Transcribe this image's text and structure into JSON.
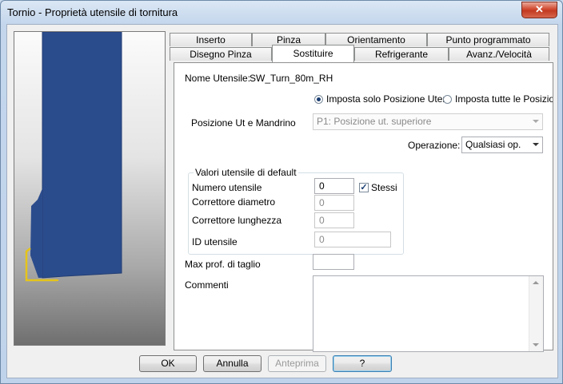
{
  "window": {
    "title": "Tornio - Proprietà utensile di tornitura",
    "close_glyph": "✕"
  },
  "tabs_row1": [
    "Inserto",
    "Pinza",
    "Orientamento",
    "Punto programmato"
  ],
  "tabs_row2": [
    "Disegno Pinza",
    "Sostituire",
    "Refrigerante",
    "Avanz./Velocità"
  ],
  "active_tab": "Sostituire",
  "form": {
    "tool_name_label": "Nome Utensile:",
    "tool_name_value": "SW_Turn_80m_RH",
    "radio_single": {
      "label": "Imposta solo Posizione Uten",
      "checked": true
    },
    "radio_all": {
      "label": "Imposta tutte le Posizio",
      "checked": false
    },
    "position_label": "Posizione Ut e Mandrino",
    "position_value": "P1: Posizione ut. superiore",
    "operation_label": "Operazione:",
    "operation_value": "Qualsiasi op.",
    "defaults_group_title": "Valori utensile di default",
    "tool_number_label": "Numero utensile",
    "tool_number_value": "0",
    "same_label": "Stessi",
    "same_checked": true,
    "diameter_corrector_label": "Correttore diametro",
    "diameter_corrector_value": "0",
    "length_corrector_label": "Correttore lunghezza",
    "length_corrector_value": "0",
    "tool_id_label": "ID utensile",
    "tool_id_value": "0",
    "max_depth_label": "Max prof. di taglio",
    "max_depth_value": "",
    "comments_label": "Commenti",
    "comments_value": ""
  },
  "buttons": {
    "ok": "OK",
    "cancel": "Annulla",
    "preview": "Anteprima",
    "help": "?"
  },
  "colors": {
    "tool_body": "#2b4c8c",
    "insert_edge": "#e5c41a"
  }
}
